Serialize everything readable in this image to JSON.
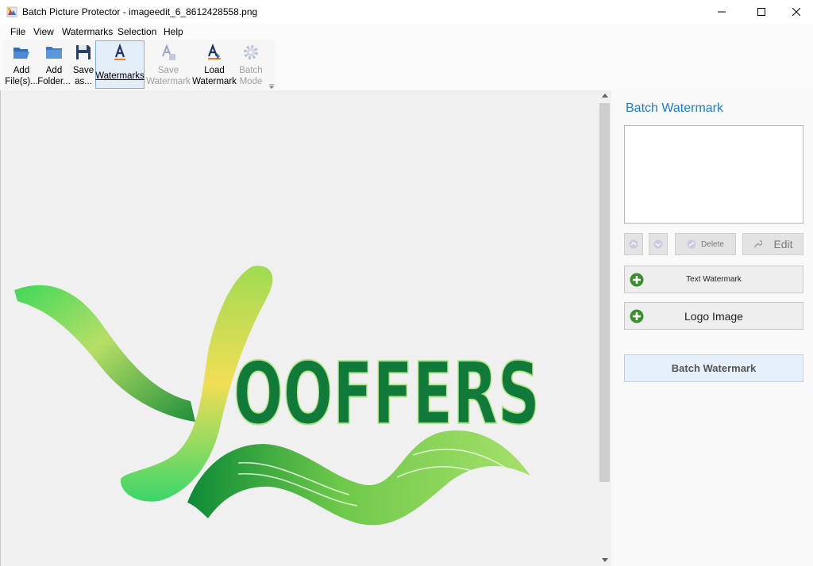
{
  "window": {
    "title": "Batch Picture Protector - imageedit_6_8612428558.png",
    "min_glyph": "—",
    "max_glyph": "☐",
    "close_glyph": "✕"
  },
  "menu": {
    "items": [
      {
        "label": "File"
      },
      {
        "label": "View"
      },
      {
        "label": "Watermarks"
      },
      {
        "label": "Selection"
      },
      {
        "label": "Help"
      }
    ]
  },
  "toolbar": {
    "items": [
      {
        "line1": "Add",
        "line2": "File(s)...",
        "icon": "folder-open-icon",
        "enabled": true
      },
      {
        "line1": "Add",
        "line2": "Folder...",
        "icon": "folder-icon",
        "enabled": true
      },
      {
        "line1": "Save",
        "line2": "as...",
        "icon": "floppy-disk-icon",
        "enabled": true
      },
      {
        "line1": "Watermarks",
        "line2": "",
        "icon": "text-watermark-icon",
        "enabled": true,
        "active": true
      },
      {
        "line1": "Save",
        "line2": "Watermark",
        "icon": "save-watermark-icon",
        "enabled": false
      },
      {
        "line1": "Load",
        "line2": "Watermark",
        "icon": "load-watermark-icon",
        "enabled": true
      },
      {
        "line1": "Batch",
        "line2": "Mode",
        "icon": "gear-icon",
        "enabled": false
      }
    ]
  },
  "canvas": {
    "logo_text": "OOFFERS",
    "logo_colors": {
      "text": "#0f7a3a",
      "brush_light": "#a8dc5a",
      "brush_yellow": "#f2de55",
      "brush_dark": "#108a3c"
    }
  },
  "panel": {
    "title": "Batch Watermark",
    "delete_label": "Delete",
    "edit_label": "Edit",
    "text_watermark_label": "Text Watermark",
    "logo_image_label": "Logo Image",
    "batch_button_label": "Batch Watermark",
    "accent": "#1e7bd0"
  }
}
